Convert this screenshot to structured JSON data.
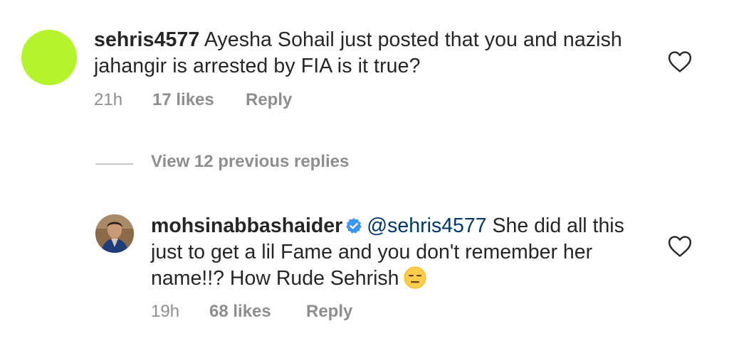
{
  "comment": {
    "username": "sehris4577",
    "text": "Ayesha Sohail just posted that you and nazish jahangir is arrested by FIA is it true?",
    "time": "21h",
    "likes": "17 likes",
    "reply_label": "Reply",
    "avatar_color": "#b5f32b"
  },
  "replies_toggle": {
    "label": "View 12 previous replies"
  },
  "reply": {
    "username": "mohsinabbashaider",
    "verified": true,
    "mention": "@sehris4577",
    "text": "She did all this just to get a lil Fame and you don't remember her name!!? How Rude Sehrish",
    "emoji": "expressionless-face-emoji",
    "time": "19h",
    "likes": "68 likes",
    "reply_label": "Reply"
  },
  "icons": {
    "like": "heart-outline-icon",
    "verified": "verified-badge-icon"
  },
  "colors": {
    "text": "#262626",
    "secondary": "#8e8e8e",
    "mention": "#00376b",
    "verified": "#3897f0"
  }
}
